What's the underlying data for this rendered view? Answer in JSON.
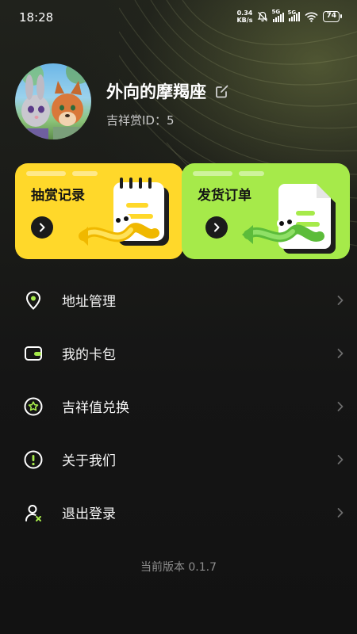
{
  "status_bar": {
    "time": "18:28",
    "net_speed_value": "0.34",
    "net_speed_unit": "KB/s",
    "sim1_type": "5G",
    "sim2_type": "5G",
    "battery": "74"
  },
  "profile": {
    "username": "外向的摩羯座",
    "id_label": "吉祥赏ID：5"
  },
  "cards": [
    {
      "label": "抽赏记录",
      "color": "#ffd82a"
    },
    {
      "label": "发货订单",
      "color": "#a6ea4a"
    }
  ],
  "menu": {
    "items": [
      {
        "label": "地址管理",
        "icon": "location-pin-icon"
      },
      {
        "label": "我的卡包",
        "icon": "wallet-icon"
      },
      {
        "label": "吉祥值兑换",
        "icon": "star-badge-icon"
      },
      {
        "label": "关于我们",
        "icon": "info-icon"
      },
      {
        "label": "退出登录",
        "icon": "logout-user-icon"
      }
    ]
  },
  "version_text": "当前版本 0.1.7"
}
